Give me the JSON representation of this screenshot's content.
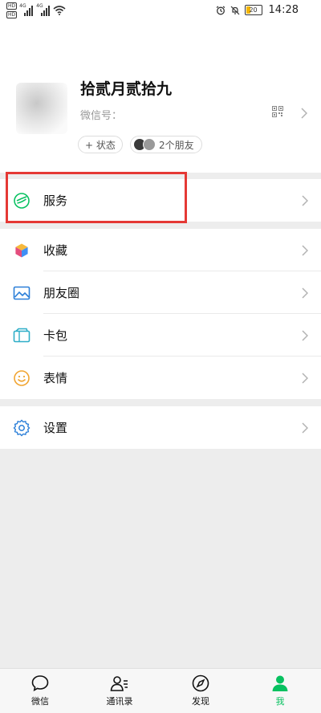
{
  "status_bar": {
    "sim_labels": [
      "HD",
      "HD"
    ],
    "network_labels": [
      "4G",
      "4G"
    ],
    "battery": "20",
    "time": "14:28"
  },
  "profile": {
    "nickname": "拾贰月贰拾九",
    "wechat_id_prefix": "微信号：",
    "status_button": "+ 状态",
    "friends_label": "2个朋友"
  },
  "menu": {
    "service": "服务",
    "favorites": "收藏",
    "moments": "朋友圈",
    "cards": "卡包",
    "stickers": "表情",
    "settings": "设置"
  },
  "tabbar": {
    "tabs": [
      {
        "label": "微信",
        "icon": "chat-icon"
      },
      {
        "label": "通讯录",
        "icon": "contacts-icon"
      },
      {
        "label": "发现",
        "icon": "compass-icon"
      },
      {
        "label": "我",
        "icon": "person-icon"
      }
    ],
    "active": "我"
  },
  "colors": {
    "accent": "#07c160",
    "highlight": "#e53935",
    "background": "#ededed"
  }
}
